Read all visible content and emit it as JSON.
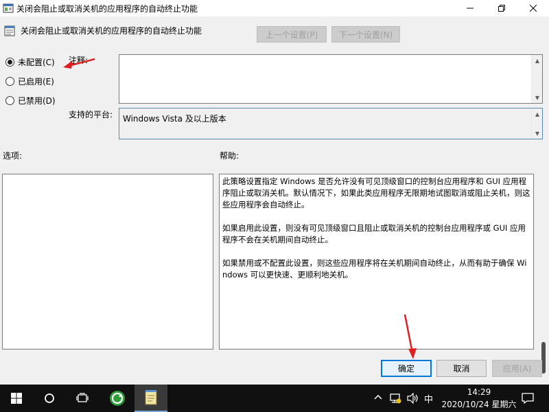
{
  "window": {
    "title": "关闭会阻止或取消关机的应用程序的自动终止功能",
    "minimize_icon": "minimize-icon",
    "maximize_icon": "restore-icon",
    "close_icon": "close-icon"
  },
  "header": {
    "policy_title": "关闭会阻止或取消关机的应用程序的自动终止功能",
    "prev_setting_label": "上一个设置(P)",
    "next_setting_label": "下一个设置(N)"
  },
  "state": {
    "options": [
      {
        "label": "未配置(C)",
        "checked": true
      },
      {
        "label": "已启用(E)",
        "checked": false
      },
      {
        "label": "已禁用(D)",
        "checked": false
      }
    ]
  },
  "comment": {
    "label": "注释:",
    "value": ""
  },
  "platform": {
    "label": "支持的平台:",
    "value": "Windows Vista 及以上版本"
  },
  "options_panel": {
    "label": "选项:"
  },
  "help_panel": {
    "label": "帮助:",
    "paragraphs": [
      "此策略设置指定 Windows 是否允许没有可见顶级窗口的控制台应用程序和 GUI 应用程序阻止或取消关机。默认情况下，如果此类应用程序无限期地试图取消或阻止关机，则这些应用程序会自动终止。",
      "如果启用此设置，则没有可见顶级窗口且阻止或取消关机的控制台应用程序或 GUI 应用程序不会在关机期间自动终止。",
      "如果禁用或不配置此设置，则这些应用程序将在关机期间自动终止，从而有助于确保 Windows 可以更快速、更顺利地关机。"
    ]
  },
  "footer": {
    "ok_label": "确定",
    "cancel_label": "取消",
    "apply_label": "应用(A)"
  },
  "taskbar": {
    "start_icon": "windows-start-icon",
    "search_icon": "cortana-circle-icon",
    "taskview_icon": "task-view-icon",
    "app1_icon": "green-refresh-app-icon",
    "app2_icon": "notepad-icon",
    "ime_label": "中",
    "time": "14:29",
    "date": "2020/10/24 星期六",
    "notification_icon": "action-center-icon"
  },
  "colors": {
    "annotation_arrow": "#e02020",
    "focus_border": "#0078d7"
  }
}
